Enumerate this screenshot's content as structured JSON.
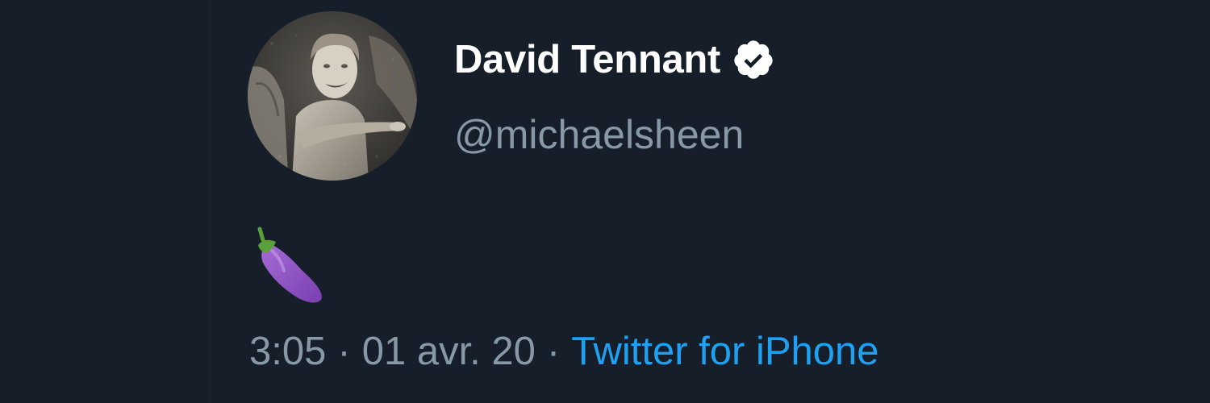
{
  "tweet": {
    "display_name": "David Tennant",
    "handle": "@michaelsheen",
    "verified": true,
    "verified_icon": "verified-badge-icon",
    "avatar_icon": "weeping-angel-avatar",
    "body_emoji_icon": "eggplant-emoji-icon",
    "time": "3:05",
    "date": "01 avr. 20",
    "separator": "·",
    "source": "Twitter for iPhone",
    "colors": {
      "background": "#161e2a",
      "name": "#ffffff",
      "secondary": "#8899a6",
      "link": "#1da1f2"
    }
  }
}
